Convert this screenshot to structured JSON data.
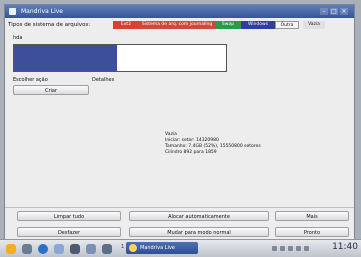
{
  "window": {
    "title": "Mandriva Live"
  },
  "filesystems": {
    "label": "Tipos de sistema de arquivos:",
    "chips": [
      {
        "label": "Ext2",
        "color": "#d64131"
      },
      {
        "label": "Sistema de arq. com journaling",
        "color": "#cf4a3a"
      },
      {
        "label": "Swap",
        "color": "#2b9a48"
      },
      {
        "label": "Windows",
        "color": "#2e3fa0"
      },
      {
        "label": "Outra",
        "color": "#f4f4f4"
      },
      {
        "label": "Vazia",
        "color": "#e0e0e0"
      }
    ]
  },
  "disk": {
    "label": "hda"
  },
  "actions": {
    "label": "Escolher ação",
    "create_label": "Criar"
  },
  "details": {
    "label": "Detalhes",
    "lines": [
      "Vazia",
      "Iniciar: setor: 14320980",
      "Tamanho: 7.4GB (52%), 15550800 setores",
      "Cilindro 892 para 1859"
    ]
  },
  "buttons": {
    "clear_all": "Limpar tudo",
    "auto_alloc": "Alocar automaticamente",
    "more": "Mais",
    "undo": "Desfazer",
    "normal_mode": "Mudar para modo normal",
    "done": "Pronto"
  },
  "taskbar": {
    "task_count": "1",
    "task_label": "Mandriva Live",
    "clock": "11:40",
    "icons": [
      "mandriva-star-icon",
      "file-manager-icon",
      "browser-icon",
      "mail-icon",
      "terminal-icon",
      "config-icon",
      "desktop-switch-icon"
    ]
  }
}
